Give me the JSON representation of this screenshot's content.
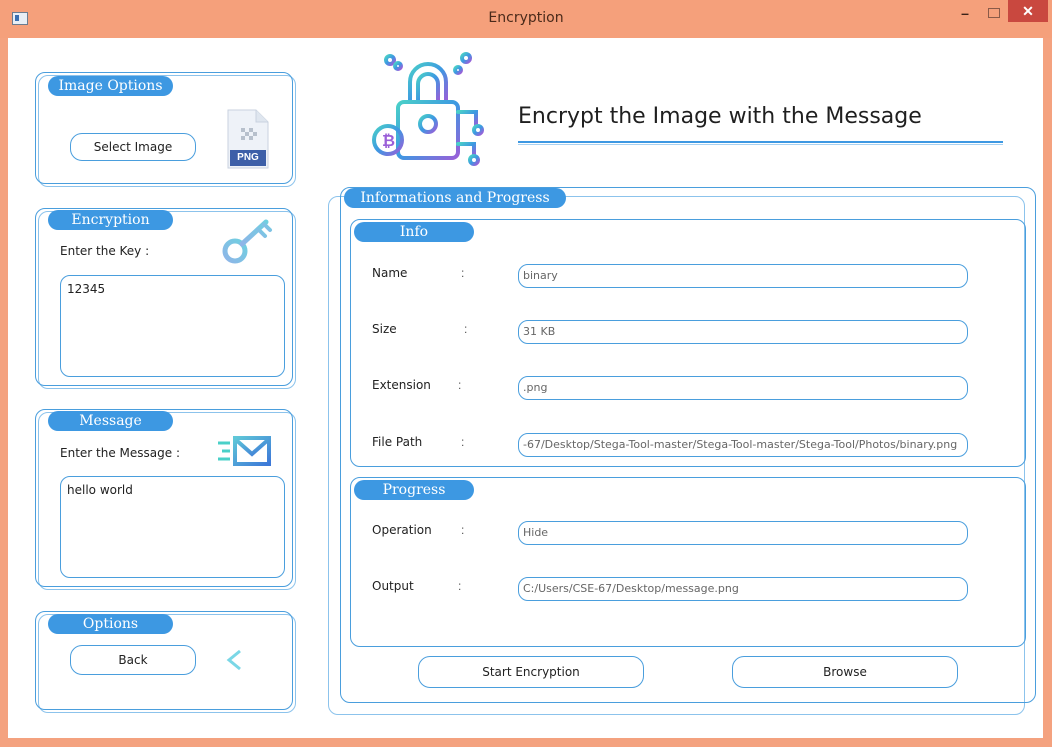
{
  "window": {
    "title": "Encryption"
  },
  "image_options": {
    "tab": "Image Options",
    "select_button": "Select Image",
    "file_badge": "PNG"
  },
  "encryption": {
    "tab": "Encryption",
    "key_label": "Enter the Key :",
    "key_value": "12345"
  },
  "message": {
    "tab": "Message",
    "message_label": "Enter the Message :",
    "message_value": "hello world"
  },
  "options": {
    "tab": "Options",
    "back_button": "Back"
  },
  "header": {
    "title": "Encrypt the Image with the Message"
  },
  "info_progress": {
    "tab": "Informations and Progress",
    "info": {
      "tab": "Info",
      "rows": [
        {
          "label": "Name",
          "colon": ":",
          "value": "binary"
        },
        {
          "label": "Size",
          "colon": ":",
          "value": "31 KB"
        },
        {
          "label": "Extension",
          "colon": ":",
          "value": ".png"
        },
        {
          "label": "File Path",
          "colon": ":",
          "value": "-67/Desktop/Stega-Tool-master/Stega-Tool-master/Stega-Tool/Photos/binary.png"
        }
      ]
    },
    "progress": {
      "tab": "Progress",
      "rows": [
        {
          "label": "Operation",
          "colon": ":",
          "value": "Hide"
        },
        {
          "label": "Output",
          "colon": ":",
          "value": "C:/Users/CSE-67/Desktop/message.png"
        }
      ]
    },
    "start_button": "Start Encryption",
    "browse_button": "Browse"
  },
  "colors": {
    "accent": "#3d98e2",
    "titlebar": "#f5a07b",
    "close": "#c9483f"
  },
  "icons": [
    "app-icon",
    "png-file-icon",
    "key-icon",
    "mail-icon",
    "back-arrow-icon",
    "security-lock-icon"
  ]
}
